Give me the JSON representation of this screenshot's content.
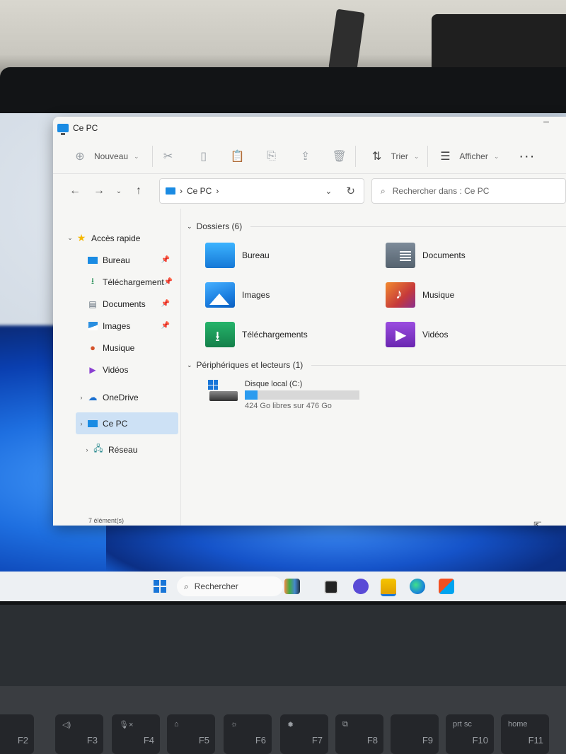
{
  "window": {
    "title": "Ce PC"
  },
  "toolbar": {
    "new_label": "Nouveau",
    "sort_label": "Trier",
    "view_label": "Afficher",
    "more_label": "···"
  },
  "address": {
    "location": "Ce PC",
    "search_placeholder": "Rechercher dans : Ce PC"
  },
  "sidebar": {
    "quick_access": "Accès rapide",
    "items": [
      {
        "label": "Bureau"
      },
      {
        "label": "Téléchargement"
      },
      {
        "label": "Documents"
      },
      {
        "label": "Images"
      },
      {
        "label": "Musique"
      },
      {
        "label": "Vidéos"
      }
    ],
    "onedrive": "OneDrive",
    "this_pc": "Ce PC",
    "network": "Réseau"
  },
  "content": {
    "folders_header": "Dossiers (6)",
    "folders": [
      {
        "label": "Bureau"
      },
      {
        "label": "Documents"
      },
      {
        "label": "Images"
      },
      {
        "label": "Musique"
      },
      {
        "label": "Téléchargements"
      },
      {
        "label": "Vidéos"
      }
    ],
    "drives_header": "Périphériques et lecteurs (1)",
    "drive": {
      "name": "Disque local (C:)",
      "free_text": "424 Go libres sur 476 Go",
      "used_fraction": 0.11
    }
  },
  "status": {
    "count": "7 élément(s)"
  },
  "taskbar": {
    "search_label": "Rechercher"
  },
  "keyboard": {
    "keys": [
      {
        "label": "F2"
      },
      {
        "label": "F3"
      },
      {
        "label": "F4"
      },
      {
        "label": "F5"
      },
      {
        "label": "F6"
      },
      {
        "label": "F7"
      },
      {
        "label": "F8"
      },
      {
        "label": "F9"
      },
      {
        "label": "F10",
        "top": "prt sc"
      },
      {
        "label": "F11",
        "top": "home"
      }
    ]
  }
}
